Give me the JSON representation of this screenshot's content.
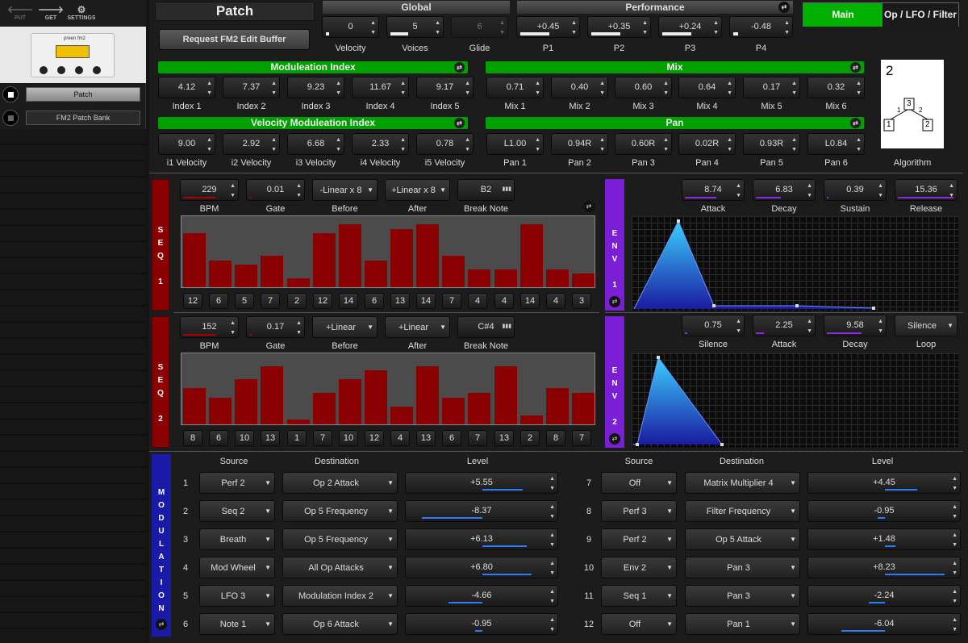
{
  "toolbar": {
    "put": "PUT",
    "get": "GET",
    "settings": "SETTINGS"
  },
  "device": {
    "label": "preen fm2"
  },
  "sidebar": {
    "items": [
      {
        "label": "Patch"
      },
      {
        "label": "FM2 Patch Bank"
      }
    ]
  },
  "title": "Patch",
  "request_button": "Request FM2 Edit Buffer",
  "global": {
    "header": "Global",
    "params": [
      {
        "label": "Velocity",
        "value": "0"
      },
      {
        "label": "Voices",
        "value": "5"
      },
      {
        "label": "Glide",
        "value": "6"
      }
    ]
  },
  "performance": {
    "header": "Performance",
    "params": [
      {
        "label": "P1",
        "value": "+0.45"
      },
      {
        "label": "P2",
        "value": "+0.35"
      },
      {
        "label": "P3",
        "value": "+0.24"
      },
      {
        "label": "P4",
        "value": "-0.48"
      }
    ]
  },
  "view_tabs": {
    "main": "Main",
    "op": "Op / LFO / Filter"
  },
  "mod_index": {
    "header": "Moduleation Index",
    "params": [
      {
        "label": "Index 1",
        "value": "4.12",
        "level": 0.2
      },
      {
        "label": "Index 2",
        "value": "7.37",
        "level": 0.25
      },
      {
        "label": "Index 3",
        "value": "9.23",
        "level": 0.45
      },
      {
        "label": "Index 4",
        "value": "11.67",
        "level": 0.7
      },
      {
        "label": "Index 5",
        "value": "9.17",
        "level": 0.25
      }
    ]
  },
  "mix": {
    "header": "Mix",
    "params": [
      {
        "label": "Mix 1",
        "value": "0.71",
        "level": 0.7
      },
      {
        "label": "Mix 2",
        "value": "0.40",
        "level": 0.4
      },
      {
        "label": "Mix 3",
        "value": "0.60",
        "level": 0.6
      },
      {
        "label": "Mix 4",
        "value": "0.64",
        "level": 0.64
      },
      {
        "label": "Mix 5",
        "value": "0.17",
        "level": 0.17
      },
      {
        "label": "Mix 6",
        "value": "0.32",
        "level": 0.32
      }
    ]
  },
  "vel_index": {
    "header": "Velocity Moduleation Index",
    "params": [
      {
        "label": "i1 Velocity",
        "value": "9.00",
        "level": 0.9
      },
      {
        "label": "i2 Velocity",
        "value": "2.92",
        "level": 0.3
      },
      {
        "label": "i3 Velocity",
        "value": "6.68",
        "level": 0.66
      },
      {
        "label": "i4 Velocity",
        "value": "2.33",
        "level": 0.23
      },
      {
        "label": "i5 Velocity",
        "value": "0.78",
        "level": 0.08
      }
    ]
  },
  "pan": {
    "header": "Pan",
    "params": [
      {
        "label": "Pan 1",
        "value": "L1.00",
        "level": 0.5
      },
      {
        "label": "Pan 2",
        "value": "0.94R",
        "level": 0.95
      },
      {
        "label": "Pan 3",
        "value": "0.60R",
        "level": 0.8
      },
      {
        "label": "Pan 4",
        "value": "0.02R",
        "level": 0.52
      },
      {
        "label": "Pan 5",
        "value": "0.93R",
        "level": 0.95
      },
      {
        "label": "Pan 6",
        "value": "L0.84",
        "level": 0.1
      }
    ]
  },
  "algorithm": {
    "label": "Algorithm",
    "value": "2",
    "ops": [
      "3",
      "1",
      "1",
      "2",
      "2"
    ]
  },
  "seq1": {
    "label": "SEQ 1",
    "bpm": "229",
    "gate": "0.01",
    "before": "-Linear x 8",
    "after": "+Linear x 8",
    "break_note": "B2",
    "labels": {
      "bpm": "BPM",
      "gate": "Gate",
      "before": "Before",
      "after": "After",
      "break": "Break Note"
    },
    "steps": [
      12,
      6,
      5,
      7,
      2,
      12,
      14,
      6,
      13,
      14,
      7,
      4,
      4,
      14,
      4,
      3
    ]
  },
  "seq2": {
    "label": "SEQ 2",
    "bpm": "152",
    "gate": "0.17",
    "before": "+Linear",
    "after": "+Linear",
    "break_note": "C#4",
    "labels": {
      "bpm": "BPM",
      "gate": "Gate",
      "before": "Before",
      "after": "After",
      "break": "Break Note"
    },
    "steps": [
      8,
      6,
      10,
      13,
      1,
      7,
      10,
      12,
      4,
      13,
      6,
      7,
      13,
      2,
      8,
      7
    ]
  },
  "env1": {
    "label": "ENV 1",
    "params": [
      {
        "label": "Attack",
        "value": "8.74"
      },
      {
        "label": "Decay",
        "value": "6.83"
      },
      {
        "label": "Sustain",
        "value": "0.39"
      },
      {
        "label": "Release",
        "value": "15.36"
      }
    ]
  },
  "env2": {
    "label": "ENV 2",
    "params": [
      {
        "label": "Silence",
        "value": "0.75"
      },
      {
        "label": "Attack",
        "value": "2.25"
      },
      {
        "label": "Decay",
        "value": "9.58"
      },
      {
        "label": "Loop",
        "value": "Silence"
      }
    ]
  },
  "modulation": {
    "label": "MODULATION",
    "headers": {
      "source": "Source",
      "destination": "Destination",
      "level": "Level"
    },
    "rows_left": [
      {
        "n": "1",
        "source": "Perf 2",
        "dest": "Op 2 Attack",
        "level": "+5.55",
        "amount": 0.555
      },
      {
        "n": "2",
        "source": "Seq 2",
        "dest": "Op 5 Frequency",
        "level": "-8.37",
        "amount": -0.837
      },
      {
        "n": "3",
        "source": "Breath",
        "dest": "Op 5 Frequency",
        "level": "+6.13",
        "amount": 0.613
      },
      {
        "n": "4",
        "source": "Mod Wheel",
        "dest": "All Op Attacks",
        "level": "+6.80",
        "amount": 0.68
      },
      {
        "n": "5",
        "source": "LFO 3",
        "dest": "Modulation Index 2",
        "level": "-4.66",
        "amount": -0.466
      },
      {
        "n": "6",
        "source": "Note 1",
        "dest": "Op 6 Attack",
        "level": "-0.95",
        "amount": -0.095
      }
    ],
    "rows_right": [
      {
        "n": "7",
        "source": "Off",
        "dest": "Matrix Multiplier 4",
        "level": "+4.45",
        "amount": 0.445
      },
      {
        "n": "8",
        "source": "Perf 3",
        "dest": "Filter Frequency",
        "level": "-0.95",
        "amount": -0.095
      },
      {
        "n": "9",
        "source": "Perf 2",
        "dest": "Op 5 Attack",
        "level": "+1.48",
        "amount": 0.148
      },
      {
        "n": "10",
        "source": "Env 2",
        "dest": "Pan 3",
        "level": "+8.23",
        "amount": 0.823
      },
      {
        "n": "11",
        "source": "Seq 1",
        "dest": "Pan 3",
        "level": "-2.24",
        "amount": -0.224
      },
      {
        "n": "12",
        "source": "Off",
        "dest": "Pan 1",
        "level": "-6.04",
        "amount": -0.604
      }
    ]
  }
}
